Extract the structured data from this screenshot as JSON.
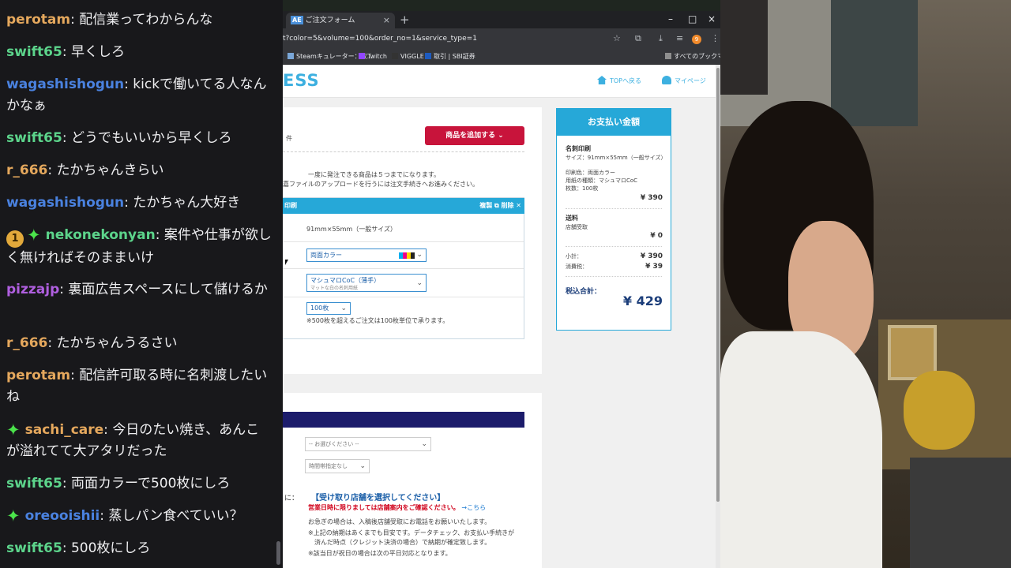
{
  "chat": {
    "messages": [
      {
        "user": "perotam",
        "color": "#e5a85d",
        "text": "配信業ってわからんな"
      },
      {
        "user": "swift65",
        "color": "#5cd48b",
        "text": "早くしろ"
      },
      {
        "user": "wagashishogun",
        "color": "#4a82e0",
        "text": "kickで働いてる人なんかなぁ"
      },
      {
        "user": "swift65",
        "color": "#5cd48b",
        "text": "どうでもいいから早くしろ"
      },
      {
        "user": "r_666",
        "color": "#e5a85d",
        "text": "たかちゃんきらい"
      },
      {
        "user": "wagashishogun",
        "color": "#4a82e0",
        "text": "たかちゃん大好き"
      },
      {
        "user": "nekonekonyan",
        "color": "#5cd48b",
        "text": "案件や仕事が欲しく無ければそのままいけ",
        "badges": [
          "1",
          "sub"
        ]
      },
      {
        "user": "pizzajp",
        "color": "#b05fe0",
        "text": "裏面広告スペースにして儲けるか"
      },
      {
        "user": "r_666",
        "color": "#e5a85d",
        "text": "たかちゃんうるさい"
      },
      {
        "user": "perotam",
        "color": "#e5a85d",
        "text": "配信許可取る時に名刺渡したいね"
      },
      {
        "user": "sachi_care",
        "color": "#e5a85d",
        "text": "今日のたい焼き、あんこが溢れてて大アタリだった",
        "badges": [
          "sub"
        ]
      },
      {
        "user": "swift65",
        "color": "#5cd48b",
        "text": "両面カラーで500枚にしろ"
      },
      {
        "user": "oreooishii",
        "color": "#4a82e0",
        "text": "蒸しパン食べていい？",
        "badges": [
          "sub"
        ]
      },
      {
        "user": "swift65",
        "color": "#5cd48b",
        "text": "500枚にしろ"
      }
    ]
  },
  "browser": {
    "tab_icon": "AE",
    "tab_title": "ご注文フォーム",
    "tab_close": "×",
    "new_tab": "+",
    "win_min": "–",
    "win_max": "□",
    "win_close": "×",
    "url": "t?color=5&volume=100&order_no=1&service_type=1",
    "ext_badge": "9",
    "bookmarks": [
      "Steamキュレーター：収...",
      "Twitch",
      "VIGGLE",
      "取引 | SBI証券"
    ],
    "bookmarks_all": "すべてのブックマーク"
  },
  "site": {
    "logo": "ESS",
    "top_link": "TOPへ戻る",
    "mypage_link": "マイページ"
  },
  "order": {
    "count_suffix": "件",
    "add_button": "商品を追加する",
    "notice1": "一度に発注できる商品は５つまでになります。",
    "notice2": "嘉ファイルのアップロードを行うには注文手続きへお進みください。",
    "item_name": "印刷",
    "item_copy": "複製",
    "item_delete": "削除",
    "size_value": "91mm×55mm（一般サイズ）",
    "color_value": "両面カラー",
    "paper_value": "マシュマロCoC（薄手）",
    "paper_sub": "マットな白の名刺用紙",
    "qty_value": "100枚",
    "qty_note": "※500枚を超えるご注文は100枚単位で承ります。"
  },
  "payment": {
    "title": "お支払い金額",
    "item_title": "名刺印刷",
    "detail_size": "サイズ：91mm×55mm（一般サイズ）",
    "detail_color": "印刷色：両面カラー",
    "detail_paper": "用紙の種類：マシュマロCoC",
    "detail_qty": "枚数：100枚",
    "item_price": "¥ 390",
    "shipping_title": "送料",
    "shipping_method": "店舗受取",
    "shipping_price": "¥ 0",
    "subtotal_label": "小計：",
    "subtotal": "¥ 390",
    "tax_label": "消費税：",
    "tax": "¥ 39",
    "total_label": "税込合計：",
    "total": "¥ 429"
  },
  "shipping": {
    "select_placeholder": "-- お選びください --",
    "time_placeholder": "時間帯指定なし",
    "colon": "に：",
    "select_store": "【受け取り店舗を選択してください】",
    "warning": "営業日時に限りましては店舗案内をご確認ください。",
    "warning_link": "→こちら",
    "note1": "お急ぎの場合は、入稿後店舗受取にお電話をお願いいたします。",
    "note2": "※上記の納期はあくまでも目安です。データチェック、お支払い手続きが",
    "note3": "済んだ時点（クレジット決済の場合）で納期が確定致します。",
    "note4": "※該当日が祝日の場合は次の平日対応となります。"
  },
  "colors": {
    "chat_bg": "#18181b",
    "site_accent": "#26a8d8",
    "add_button": "#c8143b",
    "total_text": "#1c3e7a"
  }
}
